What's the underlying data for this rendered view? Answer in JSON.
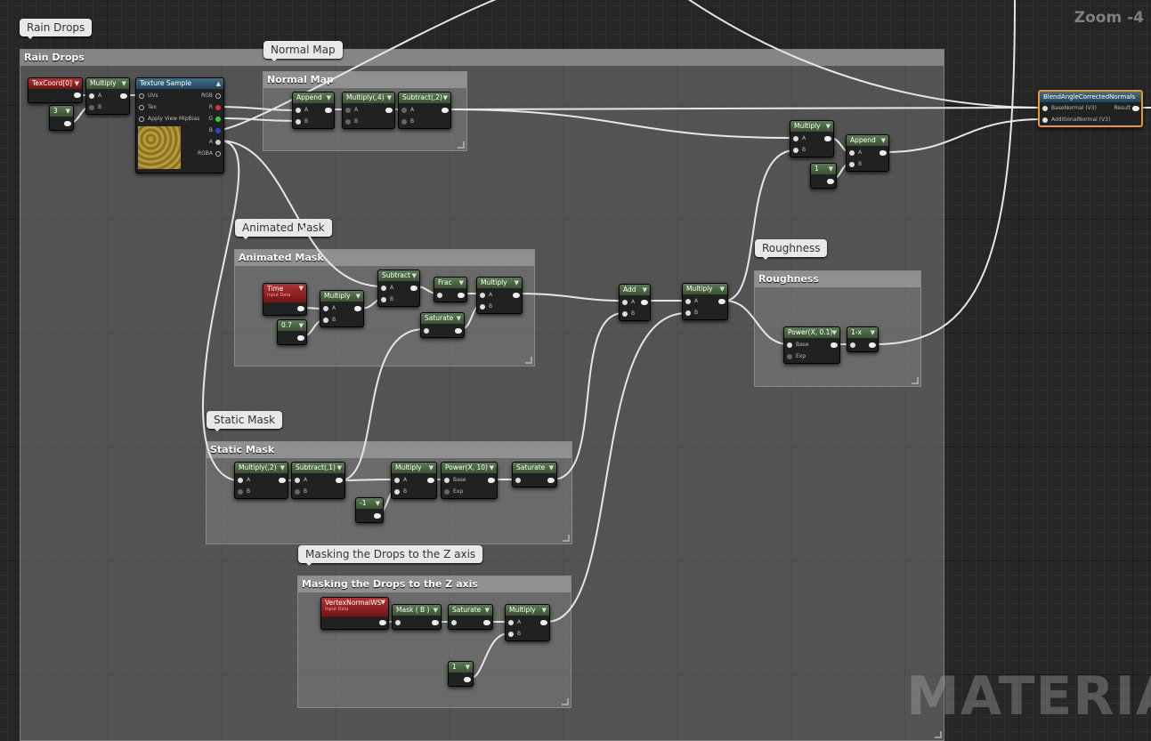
{
  "zoom_label": "Zoom -4",
  "watermark": "MATERIAL",
  "comments": {
    "rain_drops": "Rain Drops",
    "normal_map": "Normal Map",
    "animated_mask": "Animated Mask",
    "static_mask": "Static Mask",
    "masking": "Masking the Drops to the Z axis",
    "roughness": "Roughness"
  },
  "nodes": {
    "texcoord": "TexCoord[0]",
    "multiply": "Multiply",
    "const_3": "3",
    "texture_sample": "Texture Sample",
    "tex_pins": [
      "UVs",
      "Tex",
      "Apply View MipBias"
    ],
    "tex_outs": [
      "RGB",
      "R",
      "G",
      "B",
      "A",
      "RGBA"
    ],
    "append": "Append",
    "multiply_4": "Multiply(,4)",
    "subtract_2": "Subtract(,2)",
    "time": "Time",
    "input_data": "Input Data",
    "const_07": "0.7",
    "subtract": "Subtract",
    "frac": "Frac",
    "saturate": "Saturate",
    "add": "Add",
    "multiply_2": "Multiply(,2)",
    "subtract_1": "Subtract(,1)",
    "const_neg1": "-1",
    "power_10": "Power(X, 10)",
    "vertex_normal": "VertexNormalWS",
    "mask_b": "Mask ( B )",
    "const_1": "1",
    "power_01": "Power(X, 0.1)",
    "one_minus": "1-x",
    "blend": "BlendAngleCorrectedNormals",
    "blend_pins": [
      "BaseNormal (V3)",
      "AdditionalNormal (V3)"
    ],
    "result": "Result",
    "pin_a": "A",
    "pin_b": "B",
    "pin_base": "Base",
    "pin_exp": "Exp"
  }
}
